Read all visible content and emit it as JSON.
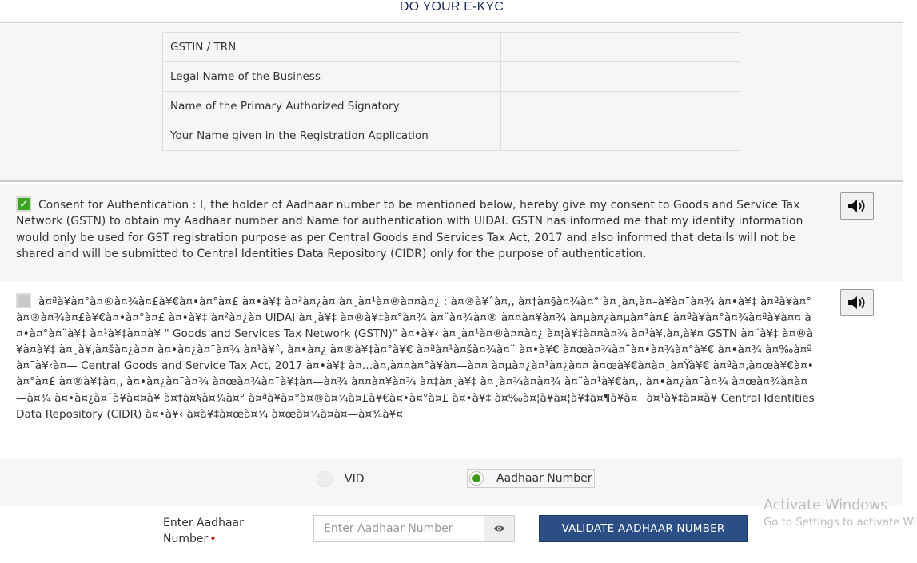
{
  "header": {
    "title": "DO YOUR E-KYC"
  },
  "info_table": {
    "rows": [
      {
        "label": "GSTIN / TRN",
        "value": ""
      },
      {
        "label": "Legal Name of the Business",
        "value": ""
      },
      {
        "label": "Name of the Primary Authorized Signatory",
        "value": ""
      },
      {
        "label": "Your Name given in the Registration Application",
        "value": ""
      }
    ]
  },
  "consent_english": {
    "checked": true,
    "text": "Consent for Authentication : I, the holder of Aadhaar number to be mentioned below, hereby give my consent to Goods and Service Tax Network (GSTN) to obtain my Aadhaar number and Name for authentication with UIDAI. GSTN has informed me that my identity information would only be used for GST registration purpose as per Central Goods and Services Tax Act, 2017 and also informed that details will not be shared and will be submitted to Central Identities Data Repository (CIDR) only for the purpose of authentication.",
    "speaker_icon": "speaker-icon"
  },
  "consent_hindi": {
    "checked": false,
    "text": "à¤ªà¥à¤°à¤®à¤¾à¤£à¥€à¤•à¤°à¤£ à¤•à¥‡ à¤²à¤¿à¤ à¤¸à¤¹à¤®à¤¤à¤¿ : à¤®à¥ˆà¤‚, à¤†à¤§à¤¾à¤° à¤¸à¤‚à¤–à¥à¤¯à¤¾ à¤•à¥‡ à¤ªà¥à¤°à¤®à¤¾à¤£à¥€à¤•à¤°à¤£ à¤•à¥‡ à¤²à¤¿à¤ UIDAI à¤¸à¥‡ à¤®à¥‡à¤°à¤¾ à¤¨à¤¾à¤® à¤¤à¤¥à¤¾ à¤µà¤¿à¤µà¤°à¤£ à¤ªà¥à¤°à¤¾à¤ªà¥à¤¤ à¤•à¤°à¤¨à¥‡ à¤¹à¥‡à¤¤à¥ \" Goods and Services Tax Network (GSTN)\" à¤•à¥‹ à¤¸à¤¹à¤®à¤¤à¤¿ à¤¦à¥‡à¤¤à¤¾ à¤¹à¥‚à¤‚à¥¤ GSTN à¤¨à¥‡ à¤®à¥à¤à¥‡ à¤¸à¥‚à¤šà¤¿à¤¤ à¤•à¤¿à¤¯à¤¾ à¤¹à¥ˆ, à¤•à¤¿ à¤®à¥‡à¤°à¥€ à¤ªà¤¹à¤šà¤¾à¤¨ à¤•à¥€ à¤œà¤¾à¤¨à¤•à¤¾à¤°à¥€ à¤•à¤¾ à¤‰à¤ªà¤¯à¥‹à¤— Central Goods and Service Tax Act, 2017 à¤•à¥‡ à¤…à¤‚à¤¤à¤°à¥à¤—à¤¤ à¤µà¤¿à¤¹à¤¿à¤¤ à¤œà¥€à¤à¤¸à¤Ÿà¥€ à¤ªà¤‚à¤œà¥€à¤•à¤°à¤£ à¤®à¥‡à¤‚, à¤•à¤¿à¤¯à¤¾ à¤œà¤¾à¤¯à¥‡à¤—à¤¾ à¤¤à¤¥à¤¾ à¤‡à¤¸à¥‡ à¤¸à¤¾à¤à¤¾ à¤¨à¤¹à¥€à¤‚, à¤•à¤¿à¤¯à¤¾ à¤œà¤¾à¤à¤—à¤¾ à¤•à¤¿à¤¨à¥à¤¤à¥ à¤†à¤§à¤¾à¤° à¤ªà¥à¤°à¤®à¤¾à¤£à¥€à¤•à¤°à¤£ à¤•à¥‡ à¤‰à¤¦à¥à¤¦à¥‡à¤¶à¥à¤¯ à¤¹à¥‡à¤¤à¥ Central Identities Data Repository (CIDR) à¤•à¥‹ à¤­à¥‡à¤œà¤¾ à¤œà¤¾à¤à¤—à¤¾à¥¤",
    "speaker_icon": "speaker-icon"
  },
  "id_type": {
    "options": [
      {
        "label": "VID",
        "selected": false
      },
      {
        "label": "Aadhaar Number",
        "selected": true
      }
    ]
  },
  "aadhaar_entry": {
    "label": "Enter Aadhaar Number",
    "required_marker": "•",
    "input_value": "",
    "placeholder": "Enter Aadhaar Number",
    "toggle_icon": "eye-icon",
    "validate_label": "VALIDATE AADHAAR NUMBER"
  },
  "colors": {
    "title": "#1b2b57",
    "panel_bg": "#f6f6f6",
    "check_green": "#3ca51f",
    "radio_green": "#3a9d16",
    "validate_btn": "#2c4e86",
    "required": "#e00000"
  },
  "os_watermark": {
    "title": "Activate Windows",
    "subtitle": "Go to Settings to activate Windows."
  }
}
